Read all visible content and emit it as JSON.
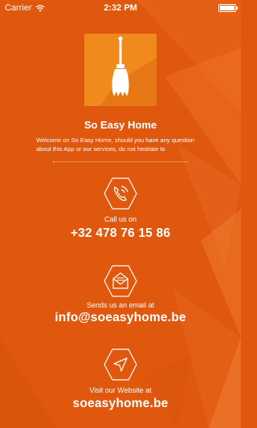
{
  "status_bar": {
    "carrier": "Carrier",
    "time": "2:32 PM"
  },
  "app": {
    "title": "So Easy Home",
    "welcome": "Welcome on So Easy Home, should you have any question about this App or our services, do not hesitate to"
  },
  "contacts": {
    "phone": {
      "caption": "Call us on",
      "value": "+32 478 76 15 86",
      "icon": "phone-icon"
    },
    "email": {
      "caption": "Sends us an email at",
      "value": "info@soeasyhome.be",
      "icon": "envelope-icon"
    },
    "website": {
      "caption": "Visit our Website at",
      "value": "soeasyhome.be",
      "icon": "navigation-arrow-icon"
    }
  },
  "colors": {
    "background": "#e0570e",
    "logo_tile": "#f08a1c",
    "text": "#ffffff"
  }
}
